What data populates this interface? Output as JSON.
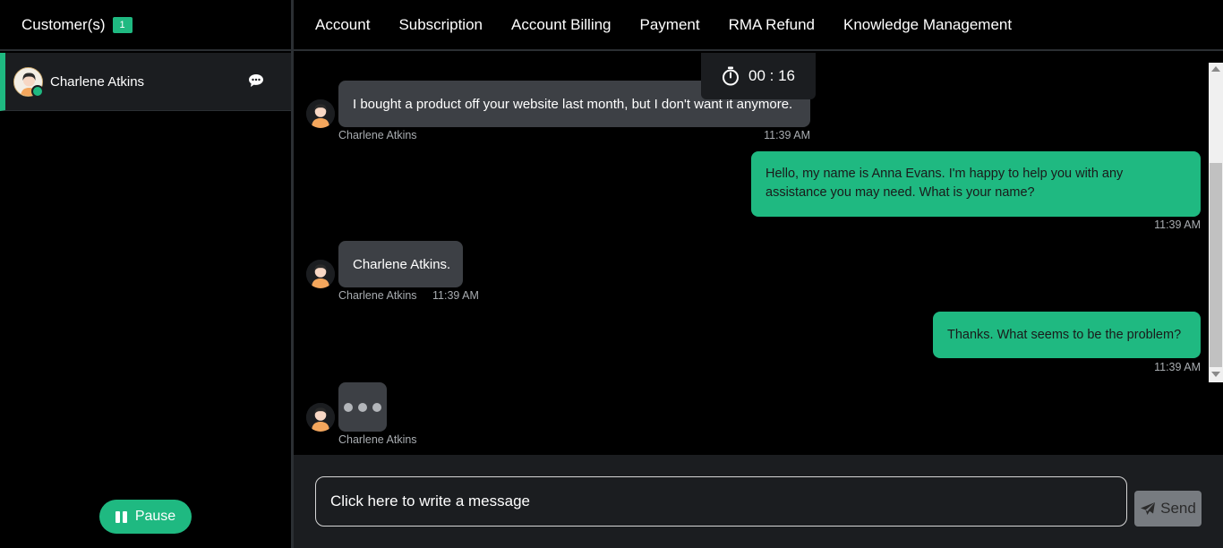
{
  "sidebar": {
    "title": "Customer(s)",
    "count": "1",
    "customers": [
      {
        "name": "Charlene Atkins",
        "status": "online"
      }
    ],
    "pause_label": "Pause"
  },
  "nav": {
    "items": [
      "Account",
      "Subscription",
      "Account Billing",
      "Payment",
      "RMA Refund",
      "Knowledge Management"
    ]
  },
  "timer": {
    "value": "00 : 16"
  },
  "messages": [
    {
      "from": "customer",
      "sender": "Charlene Atkins",
      "text": "I bought a product off your website last month, but I don't want it anymore.",
      "time": "11:39 AM"
    },
    {
      "from": "agent",
      "text": "Hello, my name is Anna Evans. I'm happy to help you with any assistance you may need. What is your name?",
      "time": "11:39 AM"
    },
    {
      "from": "customer",
      "sender": "Charlene Atkins",
      "text": "Charlene Atkins.",
      "time": "11:39 AM"
    },
    {
      "from": "agent",
      "text": "Thanks. What seems to be the problem?",
      "time": "11:39 AM"
    },
    {
      "from": "customer",
      "sender": "Charlene Atkins",
      "typing": true
    }
  ],
  "composer": {
    "placeholder": "Click here to write a message",
    "send_label": "Send"
  },
  "colors": {
    "accent": "#1fb981",
    "bubble_in": "#3d4045",
    "panel": "#1b1d20",
    "background": "#000000"
  },
  "icons": [
    "chat-bubble-icon",
    "stopwatch-icon",
    "pause-icon",
    "paper-plane-icon"
  ]
}
